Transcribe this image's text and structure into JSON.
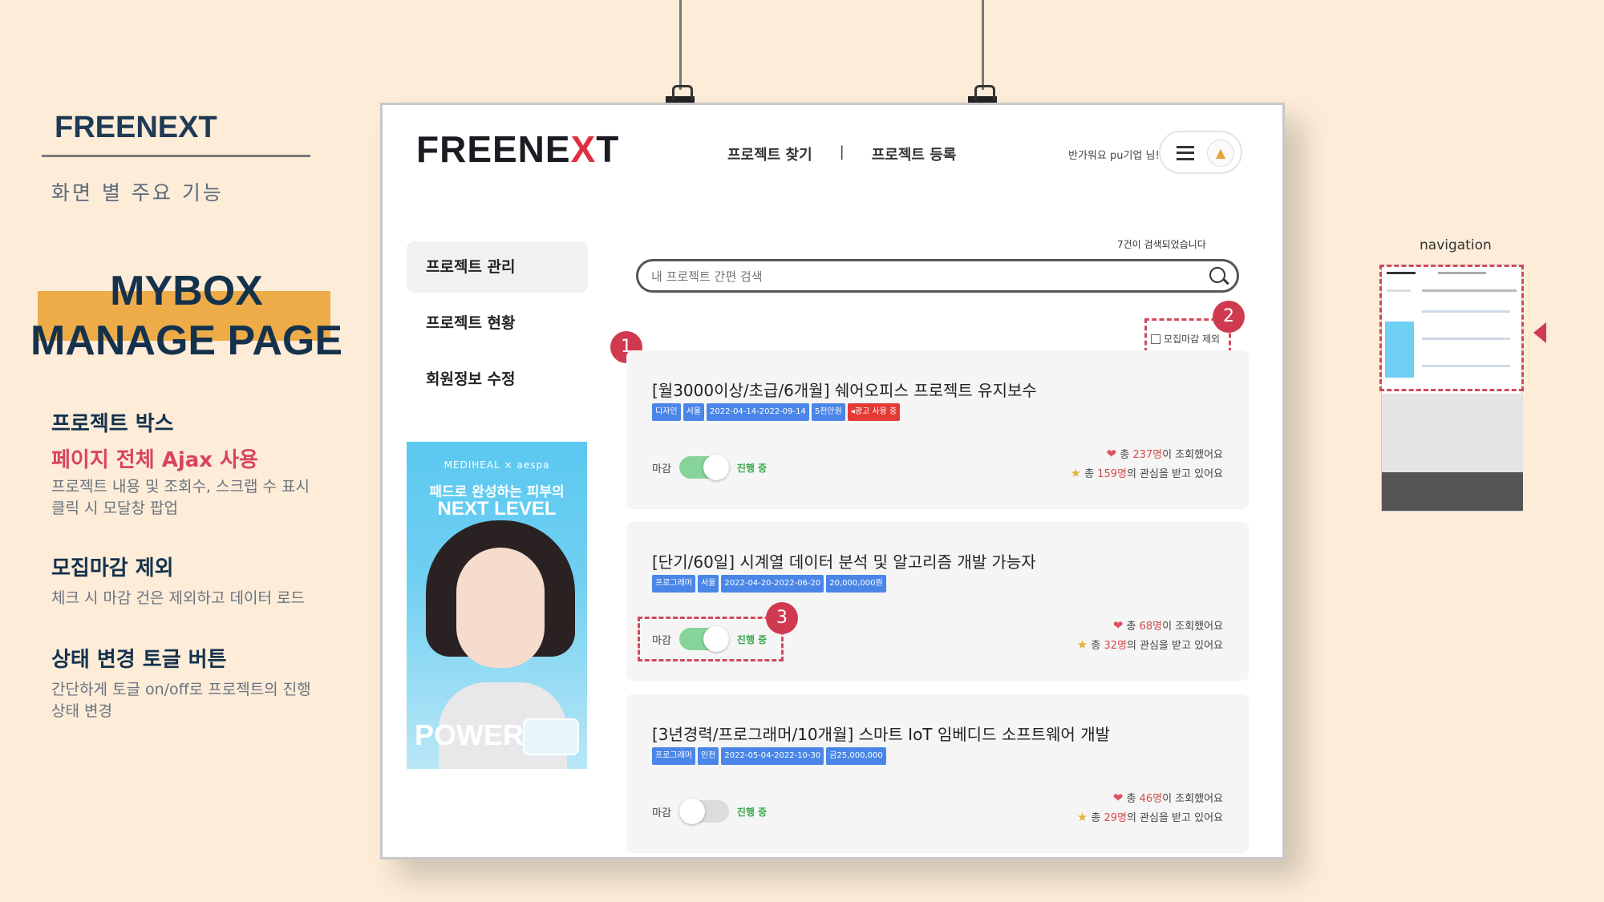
{
  "slide": {
    "brand": "FREENEXT",
    "subtitle": "화면 별 주요 기능",
    "title_line1": "MYBOX",
    "title_line2": "MANAGE PAGE",
    "features": [
      {
        "heading": "프로젝트 박스",
        "highlight": "페이지 전체 Ajax 사용",
        "desc1": "프로젝트 내용 및 조회수, 스크랩 수 표시",
        "desc2": "클릭 시 모달창 팝업"
      },
      {
        "heading": "모집마감 제외",
        "desc1": "체크 시 마감 건은 제외하고 데이터 로드"
      },
      {
        "heading": "상태 변경 토글 버튼",
        "desc1": "간단하게 토글 on/off로 프로젝트의 진행",
        "desc2": "상태 변경"
      }
    ],
    "nav_label": "navigation"
  },
  "app": {
    "logo_left": "FREEN",
    "logo_mid": "E",
    "logo_x": "X",
    "logo_right": "T",
    "nav": {
      "find": "프로젝트 찾기",
      "sep": "|",
      "register": "프로젝트 등록"
    },
    "greeting": "반가워요 pu기업 님!",
    "sidebar": [
      "프로젝트 관리",
      "프로젝트 현황",
      "회원정보 수정"
    ],
    "ad": {
      "brand": "MEDIHEAL × aespa",
      "line1": "패드로 완성하는 피부의",
      "line2": "NEXT LEVEL",
      "word": "POWER"
    },
    "result_count": "7건이 검색되었습니다",
    "search": {
      "placeholder": "내 프로젝트 간편 검색"
    },
    "exclude_label": "모집마감 제외",
    "markers": [
      "1",
      "2",
      "3"
    ],
    "toggle_label": "마감",
    "toggle_status": "진행 중",
    "projects": [
      {
        "title": "[월3000이상/초급/6개월] 쉐어오피스 프로젝트 유지보수",
        "tags": [
          "디자인",
          "서울",
          "2022-04-14-2022-09-14",
          "5천만원"
        ],
        "ad_tag": "광고 사용 중",
        "views_prefix": "총 ",
        "views": "237명",
        "views_suffix": "이 조회했어요",
        "scraps_prefix": "총 ",
        "scraps": "159명",
        "scraps_suffix": "의 관심을 받고 있어요",
        "active": true
      },
      {
        "title": "[단기/60일] 시계열 데이터 분석 및 알고리즘 개발 가능자",
        "tags": [
          "프로그래머",
          "서울",
          "2022-04-20-2022-06-20",
          "20,000,000원"
        ],
        "views_prefix": "총 ",
        "views": "68명",
        "views_suffix": "이 조회했어요",
        "scraps_prefix": "총 ",
        "scraps": "32명",
        "scraps_suffix": "의 관심을 받고 있어요",
        "active": true
      },
      {
        "title": "[3년경력/프로그래머/10개월] 스마트 IoT 임베디드 소프트웨어 개발",
        "tags": [
          "프로그래머",
          "인천",
          "2022-05-04-2022-10-30",
          "금25,000,000"
        ],
        "views_prefix": "총 ",
        "views": "46명",
        "views_suffix": "이 조회했어요",
        "scraps_prefix": "총 ",
        "scraps": "29명",
        "scraps_suffix": "의 관심을 받고 있어요",
        "active": false
      }
    ]
  },
  "colors": {
    "accent": "#d03a50",
    "navy": "#15324d",
    "highlight_bar": "#eeac49",
    "tag": "#4a86e8",
    "toggle_on": "#86d49a"
  }
}
